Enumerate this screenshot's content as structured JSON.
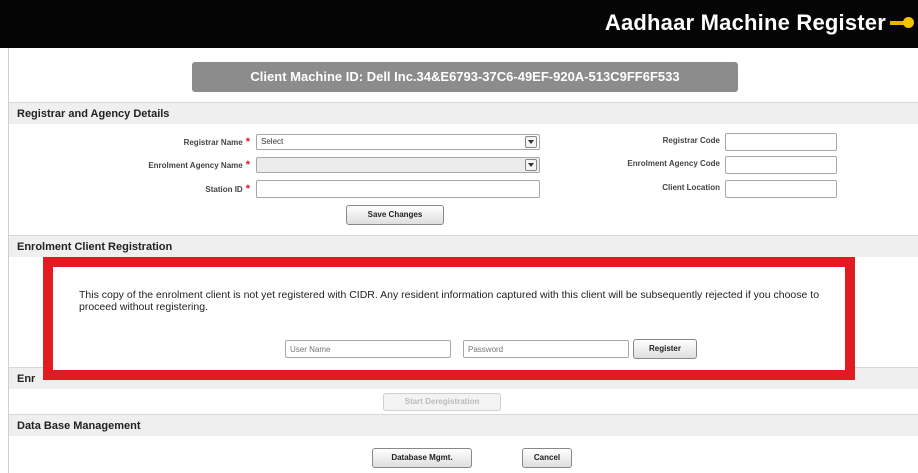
{
  "app": {
    "title": "Aadhaar Machine Register"
  },
  "client_machine": {
    "label": "Client Machine ID: Dell Inc.34&E6793-37C6-49EF-920A-513C9FF6F533"
  },
  "registrar_section": {
    "header": "Registrar and Agency Details",
    "registrar_name_label": "Registrar Name",
    "registrar_name_value": "Select",
    "agency_name_label": "Enrolment Agency Name",
    "agency_name_value": "",
    "station_id_label": "Station ID",
    "station_id_value": "",
    "registrar_code_label": "Registrar Code",
    "agency_code_label": "Enrolment Agency Code",
    "client_location_label": "Client Location",
    "required_marker": "*",
    "save_button": "Save Changes"
  },
  "enrolment_section": {
    "header": "Enrolment Client Registration",
    "notice": "This copy of the enrolment client is not yet registered with CIDR. Any resident information captured with this client will be subsequently rejected if you choose to proceed without registering.",
    "username_placeholder": "User Name",
    "password_placeholder": "Password",
    "register_button": "Register"
  },
  "deregistration_section": {
    "header_visible": "Enr",
    "start_button": "Start Deregistration"
  },
  "database_section": {
    "header": "Data Base Management",
    "mgmt_button": "Database Mgmt.",
    "cancel_button": "Cancel"
  },
  "colors": {
    "titlebar": "#050505",
    "highlight_border": "#e11b22",
    "client_id_bg": "#8c8c8c",
    "required": "#d42020"
  }
}
